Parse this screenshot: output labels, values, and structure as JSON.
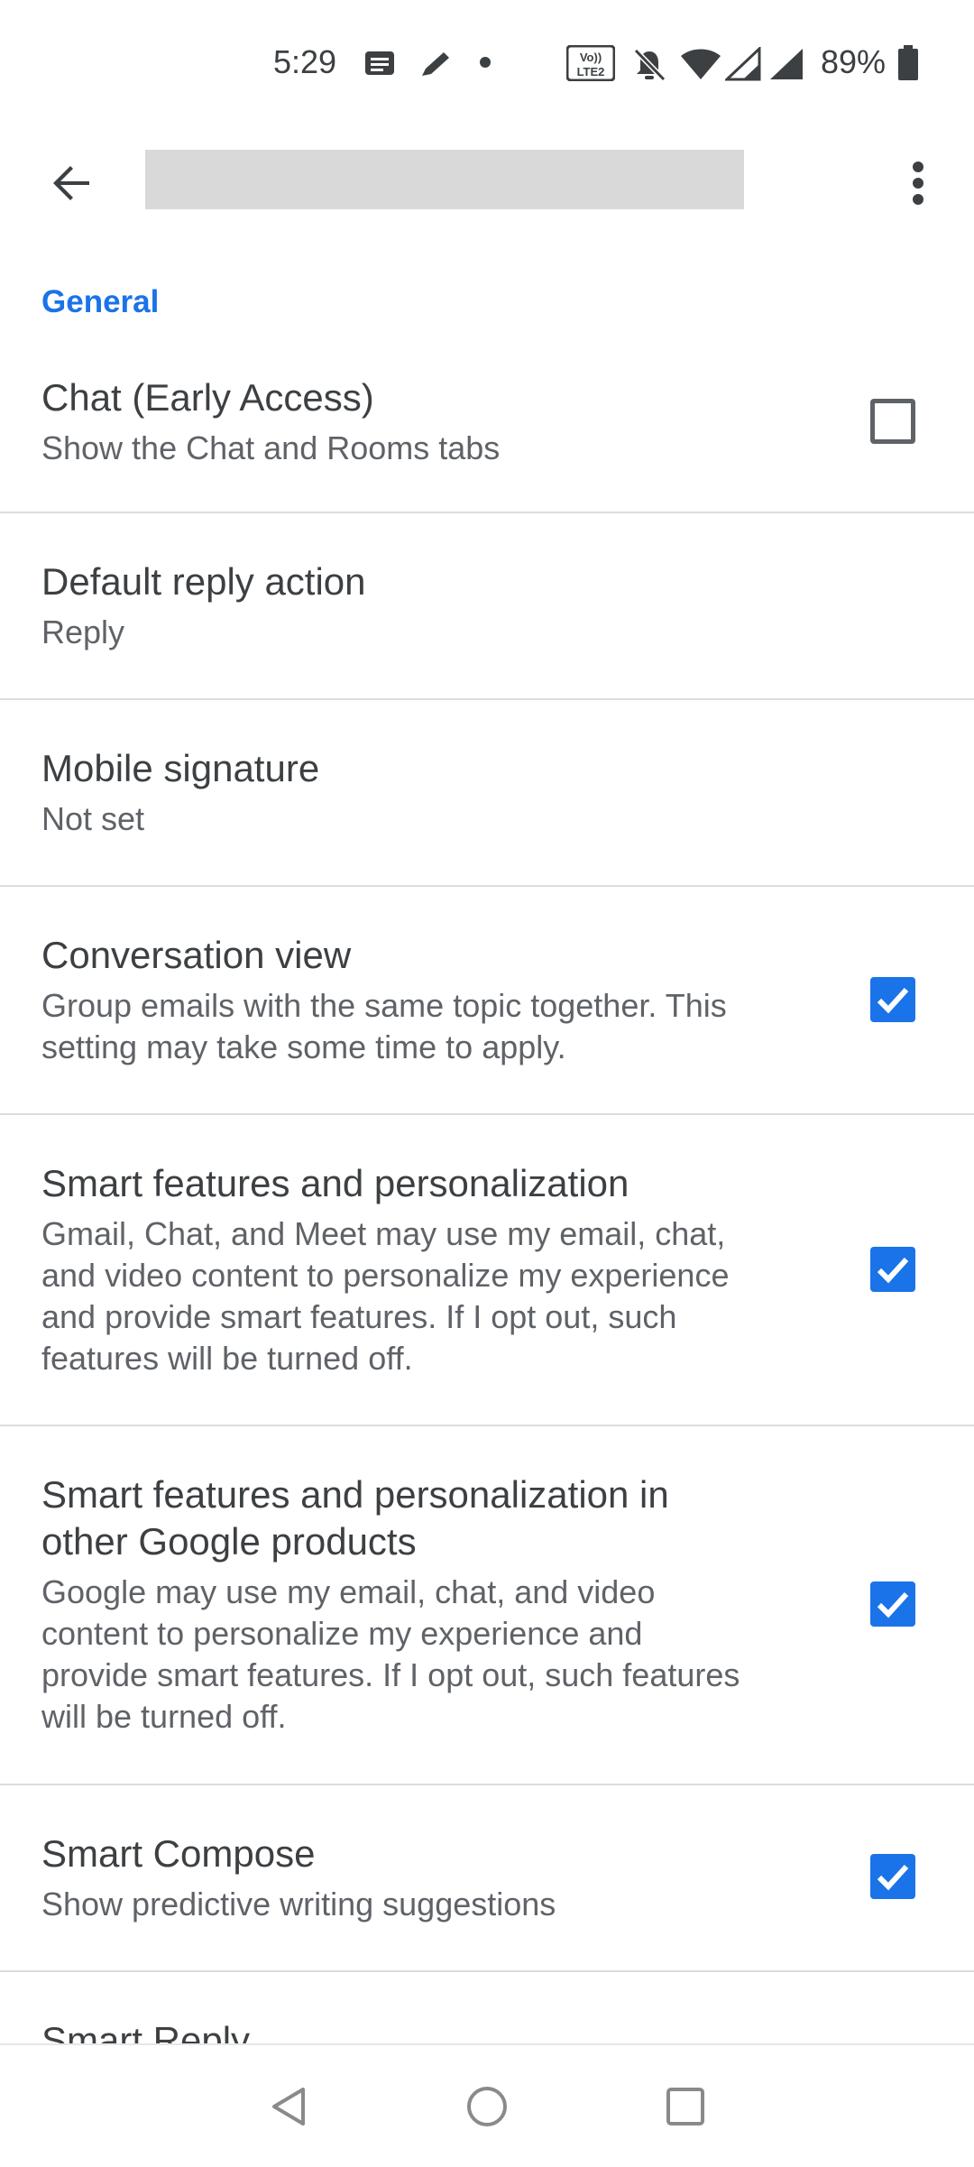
{
  "status_bar": {
    "time": "5:29",
    "battery": "89%",
    "icons": [
      "message-icon",
      "pen-icon",
      "dot-icon",
      "volte2-icon",
      "bell-off-icon",
      "wifi-icon",
      "signal-icon",
      "signal-icon",
      "battery-icon"
    ]
  },
  "app_bar": {
    "back_icon": "arrow-back-icon",
    "title_redacted": true,
    "more_icon": "more-vert-icon"
  },
  "section": {
    "header": "General"
  },
  "settings": [
    {
      "title": "Chat (Early Access)",
      "subtitle": "Show the Chat and Rooms tabs",
      "checked": false
    },
    {
      "title": "Default reply action",
      "subtitle": "Reply"
    },
    {
      "title": "Mobile signature",
      "subtitle": "Not set"
    },
    {
      "title": "Conversation view",
      "subtitle_lines": [
        "Group emails with the same topic together. This",
        "setting may take some time to apply."
      ],
      "checked": true
    },
    {
      "title": "Smart features and personalization",
      "subtitle_lines": [
        "Gmail, Chat, and Meet may use my email, chat,",
        "and video content to personalize my experience",
        "and provide smart features. If I opt out, such",
        "features will be turned off."
      ],
      "checked": true
    },
    {
      "title_lines": [
        "Smart features and personalization in",
        "other Google products"
      ],
      "subtitle_lines": [
        "Google may use my email, chat, and video",
        "content to personalize my experience and",
        "provide smart features. If I opt out, such features",
        "will be turned off."
      ],
      "checked": true
    },
    {
      "title": "Smart Compose",
      "subtitle": "Show predictive writing suggestions",
      "checked": true
    },
    {
      "title": "Smart Reply"
    }
  ],
  "colors": {
    "accent": "#1a73e8",
    "text_primary": "#3c4043",
    "text_secondary": "#5f6368",
    "divider": "#dadce0"
  },
  "nav_bar": {
    "icons": [
      "nav-back-icon",
      "nav-home-icon",
      "nav-recents-icon"
    ]
  }
}
